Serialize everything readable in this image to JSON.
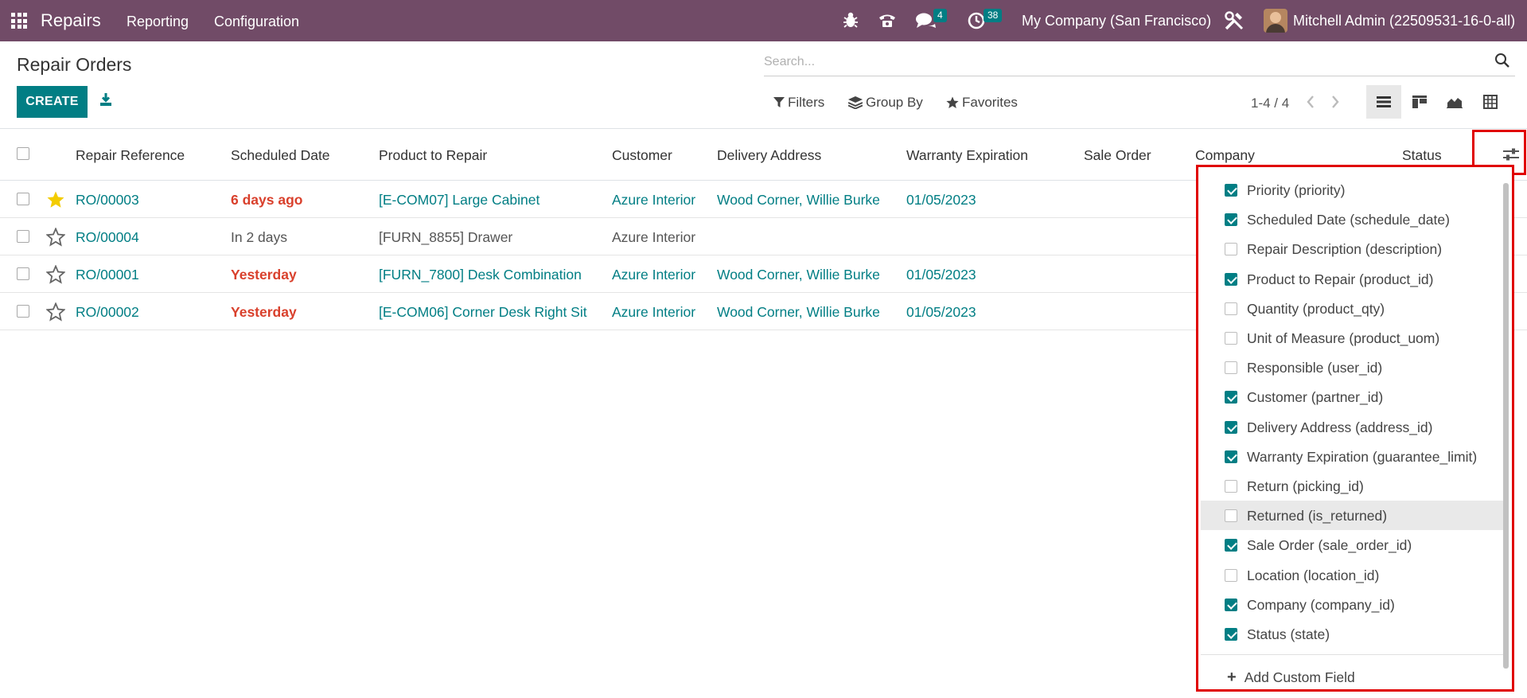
{
  "navbar": {
    "app_name": "Repairs",
    "menus": [
      "Reporting",
      "Configuration"
    ],
    "messages_count": "4",
    "activities_count": "38",
    "company": "My Company (San Francisco)",
    "user": "Mitchell Admin (22509531-16-0-all)"
  },
  "control_panel": {
    "title": "Repair Orders",
    "create_label": "CREATE",
    "search_placeholder": "Search...",
    "filters_label": "Filters",
    "group_by_label": "Group By",
    "favorites_label": "Favorites",
    "pager": "1-4 / 4"
  },
  "table": {
    "columns": [
      "Repair Reference",
      "Scheduled Date",
      "Product to Repair",
      "Customer",
      "Delivery Address",
      "Warranty Expiration",
      "Sale Order",
      "Company",
      "Status"
    ],
    "rows": [
      {
        "priority": true,
        "ref": "RO/00003",
        "date": "6 days ago",
        "date_late": true,
        "product": "[E-COM07] Large Cabinet",
        "product_link": true,
        "customer": "Azure Interior",
        "customer_link": true,
        "address": "Wood Corner, Willie Burke",
        "warranty": "01/05/2023"
      },
      {
        "priority": false,
        "ref": "RO/00004",
        "date": "In 2 days",
        "date_late": false,
        "product": "[FURN_8855] Drawer",
        "product_link": false,
        "customer": "Azure Interior",
        "customer_link": false,
        "address": "",
        "warranty": ""
      },
      {
        "priority": false,
        "ref": "RO/00001",
        "date": "Yesterday",
        "date_late": true,
        "product": "[FURN_7800] Desk Combination",
        "product_link": true,
        "customer": "Azure Interior",
        "customer_link": true,
        "address": "Wood Corner, Willie Burke",
        "warranty": "01/05/2023"
      },
      {
        "priority": false,
        "ref": "RO/00002",
        "date": "Yesterday",
        "date_late": true,
        "product": "[E-COM06] Corner Desk Right Sit",
        "product_link": true,
        "customer": "Azure Interior",
        "customer_link": true,
        "address": "Wood Corner, Willie Burke",
        "warranty": "01/05/2023"
      }
    ]
  },
  "optional_columns": {
    "items": [
      {
        "label": "Priority (priority)",
        "checked": true
      },
      {
        "label": "Scheduled Date (schedule_date)",
        "checked": true
      },
      {
        "label": "Repair Description (description)",
        "checked": false
      },
      {
        "label": "Product to Repair (product_id)",
        "checked": true
      },
      {
        "label": "Quantity (product_qty)",
        "checked": false
      },
      {
        "label": "Unit of Measure (product_uom)",
        "checked": false
      },
      {
        "label": "Responsible (user_id)",
        "checked": false
      },
      {
        "label": "Customer (partner_id)",
        "checked": true
      },
      {
        "label": "Delivery Address (address_id)",
        "checked": true
      },
      {
        "label": "Warranty Expiration (guarantee_limit)",
        "checked": true
      },
      {
        "label": "Return (picking_id)",
        "checked": false
      },
      {
        "label": "Returned (is_returned)",
        "checked": false,
        "hover": true
      },
      {
        "label": "Sale Order (sale_order_id)",
        "checked": true
      },
      {
        "label": "Location (location_id)",
        "checked": false
      },
      {
        "label": "Company (company_id)",
        "checked": true
      },
      {
        "label": "Status (state)",
        "checked": true
      }
    ],
    "add_custom_field": "Add Custom Field"
  },
  "colors": {
    "navbar": "#714b67",
    "primary": "#017e84",
    "late": "#d9402c",
    "star": "#f3cc00",
    "highlight_border": "#e00000"
  }
}
